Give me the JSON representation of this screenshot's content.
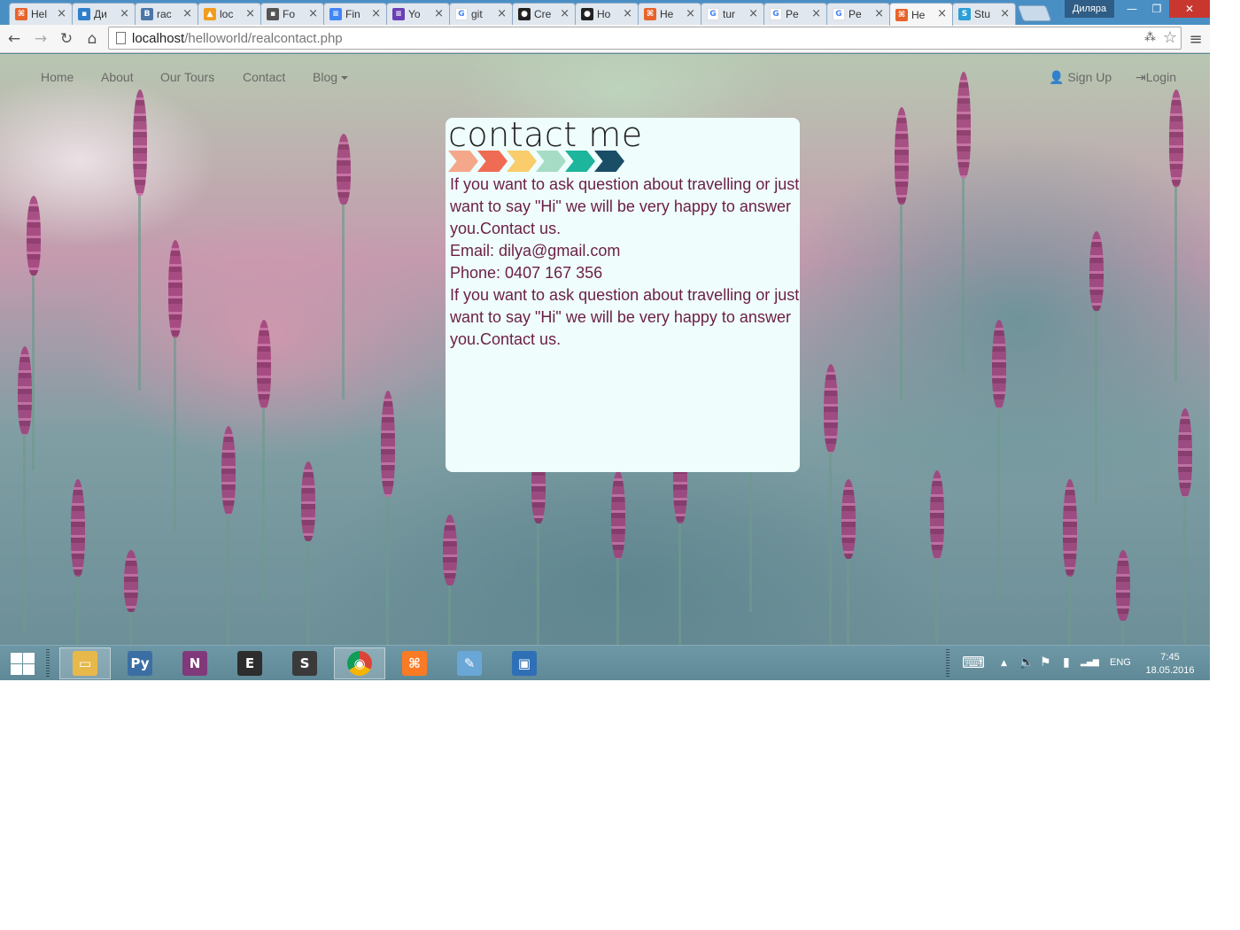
{
  "browser": {
    "tabs": [
      {
        "title": "Hel",
        "favicon": "xampp",
        "color": "#e8632b",
        "glyph": "⌘"
      },
      {
        "title": "Ди",
        "favicon": "chat",
        "color": "#2f7fcb",
        "glyph": "▪"
      },
      {
        "title": "rac",
        "favicon": "vk",
        "color": "#4a76a8",
        "glyph": "B"
      },
      {
        "title": "loc",
        "favicon": "phpmyadmin",
        "color": "#f29c1f",
        "glyph": "▲"
      },
      {
        "title": "Fo",
        "favicon": "contact",
        "color": "#555555",
        "glyph": "▪"
      },
      {
        "title": "Fin",
        "favicon": "docs",
        "color": "#4285f4",
        "glyph": "≡"
      },
      {
        "title": "Yo",
        "favicon": "forms",
        "color": "#6a3fb5",
        "glyph": "≡"
      },
      {
        "title": "git",
        "favicon": "google",
        "color": "#ffffff",
        "glyph": "G"
      },
      {
        "title": "Cre",
        "favicon": "github",
        "color": "#222222",
        "glyph": "●"
      },
      {
        "title": "Ho",
        "favicon": "github",
        "color": "#222222",
        "glyph": "●"
      },
      {
        "title": "He",
        "favicon": "xampp",
        "color": "#e8632b",
        "glyph": "⌘"
      },
      {
        "title": "tur",
        "favicon": "google",
        "color": "#ffffff",
        "glyph": "G"
      },
      {
        "title": "Pe",
        "favicon": "google",
        "color": "#ffffff",
        "glyph": "G"
      },
      {
        "title": "Pe",
        "favicon": "google",
        "color": "#ffffff",
        "glyph": "G"
      },
      {
        "title": "He",
        "favicon": "xampp",
        "color": "#e8632b",
        "glyph": "⌘",
        "active": true
      },
      {
        "title": "Stu",
        "favicon": "stepik",
        "color": "#2c9fd6",
        "glyph": "S"
      }
    ],
    "close_glyph": "×",
    "user_name": "Дилярa",
    "window_controls": {
      "minimize": "—",
      "restore": "❐",
      "close": "✕"
    },
    "toolbar": {
      "back": "←",
      "forward": "→",
      "reload": "↻",
      "home": "⌂",
      "menu": "≡",
      "translate": "⁂",
      "star": "☆"
    },
    "url": {
      "host": "localhost",
      "path": "/helloworld/realcontact.php"
    }
  },
  "site": {
    "nav": {
      "home": "Home",
      "about": "About",
      "tours": "Our Tours",
      "contact": "Contact",
      "blog": "Blog",
      "signup": "Sign Up",
      "login": "Login",
      "user_icon": "👤",
      "login_icon": "⇥"
    },
    "contact": {
      "heading": "contact me",
      "chevron_colors": [
        "#f5a889",
        "#f06b53",
        "#f9cd6b",
        "#a6dcc5",
        "#1db59b",
        "#1a4d66"
      ],
      "intro": "If you want to ask question about travelling or just want to say \"Hi\" we will be very happy to answer you.Contact us.",
      "email": "Email: dilya@gmail.com",
      "phone": "Phone: 0407 167 356",
      "outro": "If you want to ask question about travelling or just want to say \"Hi\" we will be very happy to answer you.Contact us."
    }
  },
  "taskbar": {
    "apps": [
      {
        "name": "file-explorer",
        "color": "#e7b94b",
        "glyph": "▭"
      },
      {
        "name": "python",
        "color": "#3b6fa3",
        "glyph": "Py"
      },
      {
        "name": "onenote",
        "color": "#80397b",
        "glyph": "N"
      },
      {
        "name": "terminal",
        "color": "#2d2d2d",
        "glyph": "E"
      },
      {
        "name": "sublime-text",
        "color": "#3a3a3a",
        "glyph": "S"
      },
      {
        "name": "chrome",
        "color": "#db4437",
        "glyph": "◉",
        "active": true
      },
      {
        "name": "xampp",
        "color": "#fb7a24",
        "glyph": "⌘"
      },
      {
        "name": "paint",
        "color": "#6aa6d6",
        "glyph": "✎"
      },
      {
        "name": "photos",
        "color": "#2f6fb5",
        "glyph": "▣"
      }
    ],
    "tray": {
      "keyboard": "⌨",
      "arrow": "▲",
      "volume": "🔈",
      "flag": "⚑",
      "battery": "▮",
      "signal": "▂▄▆",
      "language": "ENG"
    },
    "clock": {
      "time": "7:45",
      "date": "18.05.2016"
    }
  }
}
